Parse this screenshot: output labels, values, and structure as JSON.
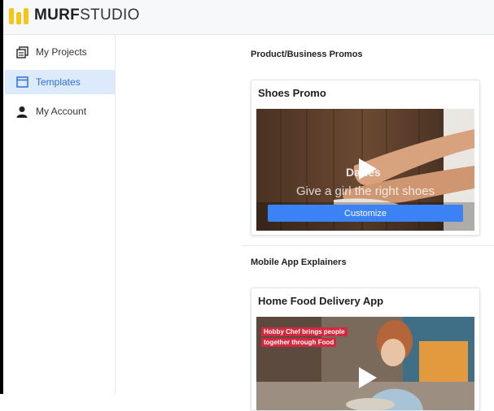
{
  "app": {
    "logo_bold": "MURF",
    "logo_light": "STUDIO",
    "accent_color": "#3b82f6",
    "logo_color": "#f5c518"
  },
  "sidebar": {
    "items": [
      {
        "label": "My Projects",
        "icon": "projects-icon",
        "active": false
      },
      {
        "label": "Templates",
        "icon": "templates-icon",
        "active": true
      },
      {
        "label": "My Account",
        "icon": "account-icon",
        "active": false
      }
    ]
  },
  "sections": [
    {
      "title": "Product/Business Promos",
      "card": {
        "title": "Shoes Promo",
        "overlay_title": "Daries",
        "overlay_subtitle": "Give a girl the right shoes",
        "button_label": "Customize"
      }
    },
    {
      "title": "Mobile App Explainers",
      "card": {
        "title": "Home Food Delivery App",
        "tag_line_1": "Hobby Chef brings people",
        "tag_line_2": "together through Food"
      }
    }
  ]
}
